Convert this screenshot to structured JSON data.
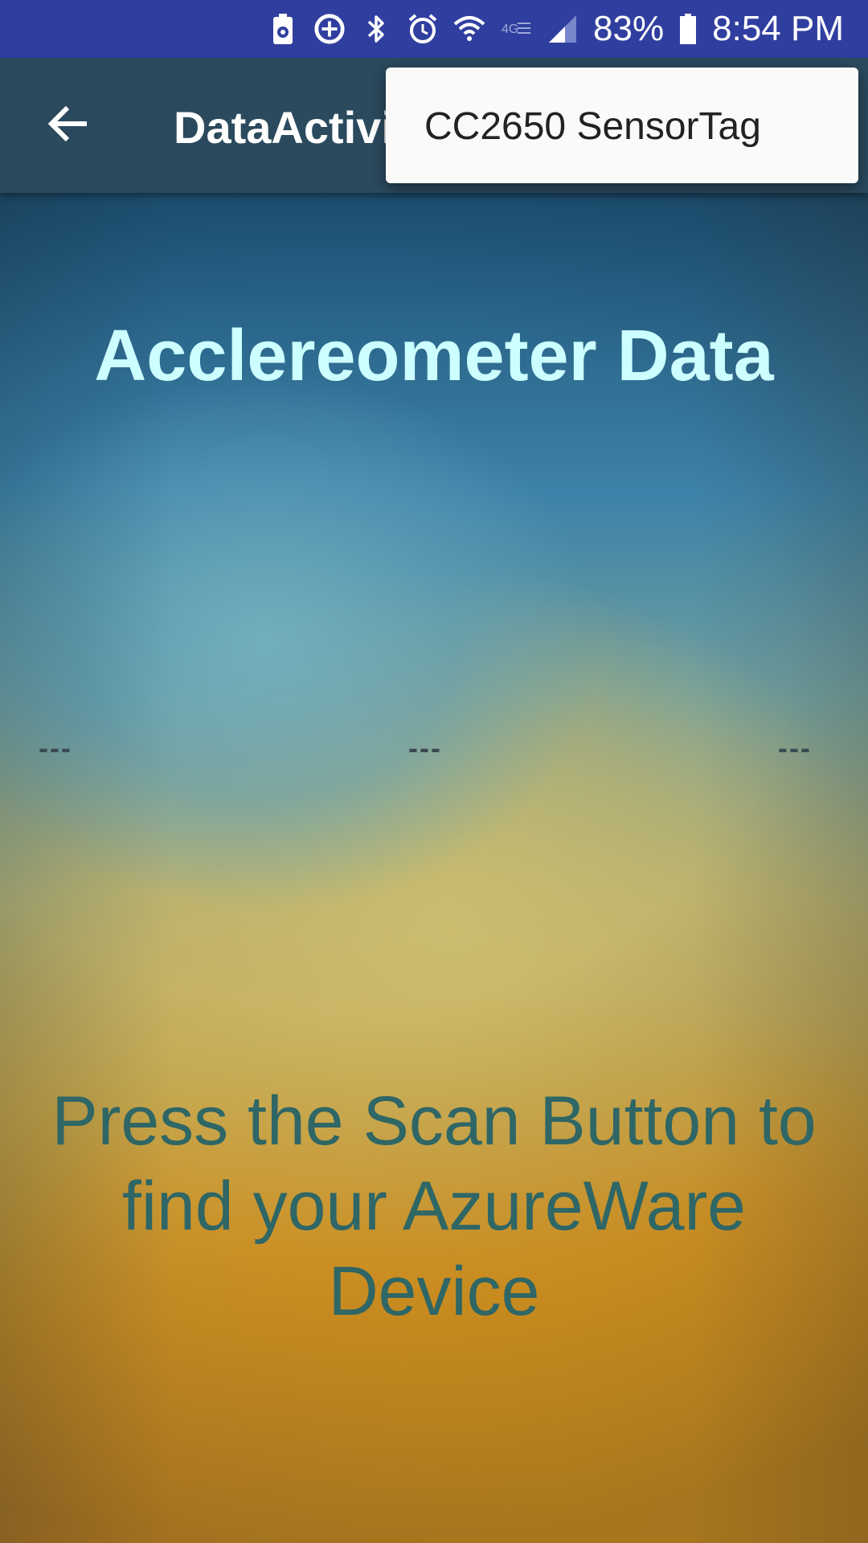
{
  "status_bar": {
    "battery_percent": "83%",
    "time": "8:54 PM",
    "icons": [
      "battery-saver-icon",
      "data-saver-icon",
      "bluetooth-icon",
      "alarm-icon",
      "wifi-icon",
      "volte-icon",
      "signal-icon",
      "battery-icon"
    ]
  },
  "app_bar": {
    "title": "DataActivity",
    "back_icon": "arrow-back-icon"
  },
  "popup_menu": {
    "items": [
      {
        "label": "CC2650 SensorTag"
      }
    ]
  },
  "main": {
    "heading": "Acclereometer Data",
    "values": {
      "x": "---",
      "y": "---",
      "z": "---"
    },
    "instruction": "Press the Scan Button to find your AzureWare Device"
  },
  "colors": {
    "status_bar": "#303f9f",
    "app_bar": "#2b4a5e",
    "heading": "#ccffff",
    "instruction": "#2f6666"
  }
}
